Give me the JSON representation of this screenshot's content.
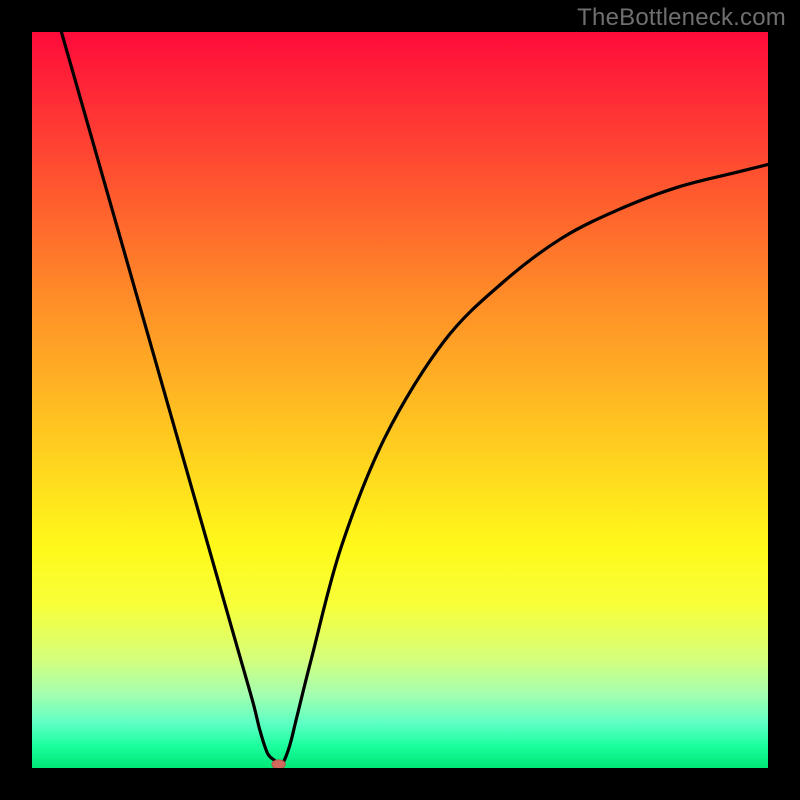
{
  "watermark": "TheBottleneck.com",
  "colors": {
    "frame": "#000000",
    "curve": "#000000",
    "marker_fill": "#d06a5f",
    "marker_stroke": "#b85548"
  },
  "chart_data": {
    "type": "line",
    "title": "",
    "xlabel": "",
    "ylabel": "",
    "xlim": [
      0,
      100
    ],
    "ylim": [
      0,
      100
    ],
    "x": [
      4,
      8,
      12,
      16,
      20,
      24,
      28,
      30,
      31,
      32,
      33,
      33.5,
      34,
      35,
      36,
      38,
      42,
      48,
      56,
      64,
      72,
      80,
      88,
      96,
      100
    ],
    "y": [
      100,
      86,
      72,
      58,
      44,
      30,
      16,
      9,
      5,
      2,
      1,
      0.5,
      0.5,
      3,
      7,
      15,
      30,
      45,
      58,
      66,
      72,
      76,
      79,
      81,
      82
    ],
    "marker": {
      "x": 33.5,
      "y": 0.5,
      "rx": 0.9,
      "ry": 0.6
    },
    "grid": false,
    "legend": false
  }
}
